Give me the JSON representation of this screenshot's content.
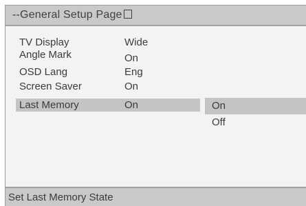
{
  "header": {
    "title": "--General Setup Page"
  },
  "menu": {
    "items": [
      {
        "label": "TV Display",
        "value": "Wide"
      },
      {
        "label": "Angle Mark",
        "value": "On"
      },
      {
        "label": "OSD Lang",
        "value": "Eng"
      },
      {
        "label": "Screen Saver",
        "value": "On"
      },
      {
        "label": "Last Memory",
        "value": "On",
        "selected": true
      }
    ]
  },
  "options": {
    "items": [
      {
        "label": "On",
        "selected": true
      },
      {
        "label": "Off"
      }
    ]
  },
  "footer": {
    "status": "Set Last Memory State"
  },
  "colors": {
    "background": "#f3f3f3",
    "bar": "#c9c9c9",
    "highlight": "#c4c4c4",
    "text": "#3b3b3b"
  }
}
